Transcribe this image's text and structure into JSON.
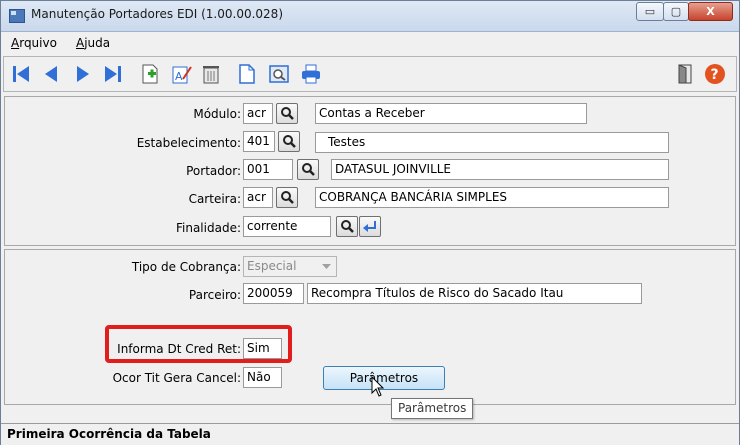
{
  "window": {
    "title": "Manutenção Portadores EDI (1.00.00.028)"
  },
  "window_controls": {
    "minimize": "▭",
    "maximize": "▢",
    "close": "X"
  },
  "menu": [
    {
      "first": "A",
      "rest": "rquivo"
    },
    {
      "first": "A",
      "rest": "juda"
    }
  ],
  "toolbar_icons": [
    "first-record-icon",
    "previous-record-icon",
    "next-record-icon",
    "last-record-icon",
    "add-icon",
    "edit-icon",
    "delete-icon",
    "new-document-icon",
    "zoom-icon",
    "print-icon",
    "exit-icon",
    "help-icon"
  ],
  "form": {
    "modulo": {
      "label": "Módulo:",
      "code": "acr",
      "desc": "Contas a Receber"
    },
    "estabelecimento": {
      "label": "Estabelecimento:",
      "code": "401",
      "desc": "Testes"
    },
    "portador": {
      "label": "Portador:",
      "code": "001",
      "desc": "DATASUL JOINVILLE"
    },
    "carteira": {
      "label": "Carteira:",
      "code": "acr",
      "desc": "COBRANÇA BANCÁRIA SIMPLES"
    },
    "finalidade": {
      "label": "Finalidade:",
      "value": "corrente"
    }
  },
  "details": {
    "tipo_cobranca": {
      "label": "Tipo de Cobrança:",
      "value": "Especial"
    },
    "parceiro": {
      "label": "Parceiro:",
      "code": "200059",
      "desc": "Recompra Títulos de Risco do Sacado Itau"
    },
    "informa_dt": {
      "label": "Informa Dt Cred Ret:",
      "value": "Sim"
    },
    "ocor_tit": {
      "label": "Ocor Tit Gera Cancel:",
      "value": "Não"
    },
    "parametros_button": "Parâmetros",
    "tooltip": "Parâmetros"
  },
  "status": {
    "text": "Primeira Ocorrência da Tabela"
  },
  "colors": {
    "highlight": "#e01e1e",
    "toolbar_blue": "#2f6fd6"
  }
}
